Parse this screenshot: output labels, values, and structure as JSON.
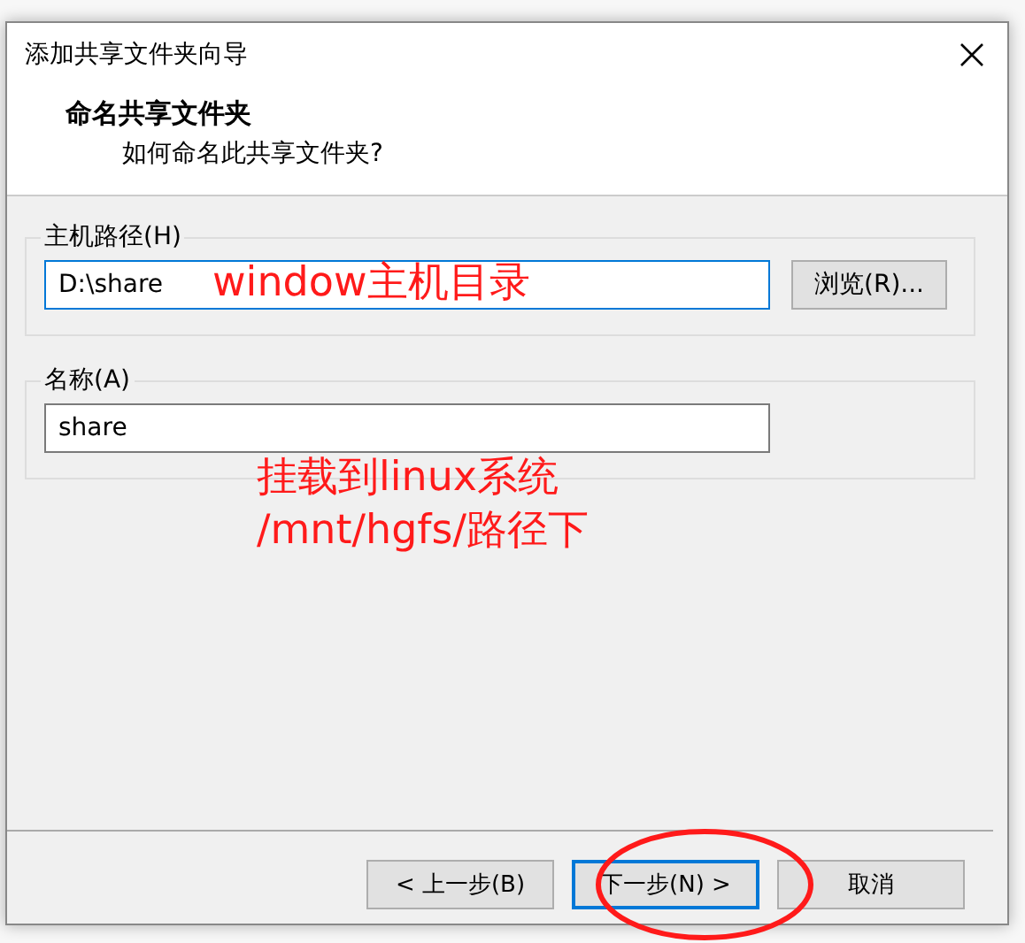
{
  "window": {
    "title": "添加共享文件夹向导"
  },
  "header": {
    "title": "命名共享文件夹",
    "subtitle": "如何命名此共享文件夹?"
  },
  "groups": [
    {
      "label": "主机路径(H)",
      "value": "D:\\share",
      "focused": true,
      "button": "浏览(R)..."
    },
    {
      "label": "名称(A)",
      "value": "share",
      "focused": false
    }
  ],
  "buttons": [
    {
      "label": "< 上一步(B)",
      "default": false
    },
    {
      "label": "下一步(N) >",
      "default": true
    },
    {
      "label": "取消",
      "default": false
    }
  ],
  "annotations": [
    {
      "kind": "text",
      "lines": [
        "window主机目录"
      ]
    },
    {
      "kind": "text",
      "lines": [
        "挂载到linux系统",
        "/mnt/hgfs/路径下"
      ]
    },
    {
      "kind": "ellipse"
    }
  ]
}
